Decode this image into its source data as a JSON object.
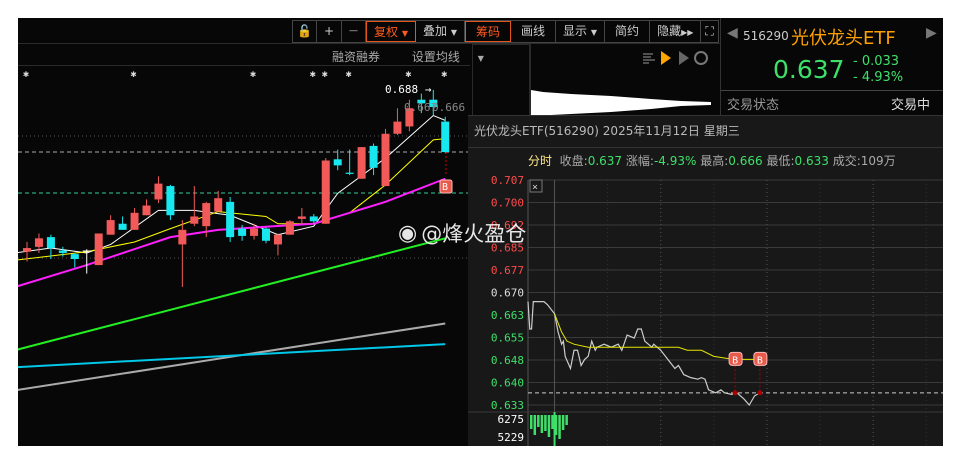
{
  "toolbar": {
    "lock": "🔓",
    "plus": "+",
    "minus": "—",
    "fuquan": "复权",
    "overlay": "叠加",
    "chips": "筹码",
    "draw": "画线",
    "display": "显示",
    "simple": "简约",
    "hide": "隐藏",
    "fullscreen": "⛶"
  },
  "subbar": {
    "margin": "融资融券",
    "ma_setting": "设置均线"
  },
  "quote": {
    "code": "516290",
    "name": "光伏龙头ETF",
    "price": "0.637",
    "change": "- 0.033",
    "change_pct": "- 4.93%",
    "status_label": "交易状态",
    "status_value": "交易中"
  },
  "kline": {
    "high_label": "0.688",
    "label_666": "0.666",
    "label_667": "0.667",
    "candles": [
      [
        0.555,
        0.563,
        0.547,
        0.558
      ],
      [
        0.559,
        0.57,
        0.554,
        0.566
      ],
      [
        0.567,
        0.569,
        0.549,
        0.558
      ],
      [
        0.556,
        0.559,
        0.551,
        0.554
      ],
      [
        0.553,
        0.554,
        0.542,
        0.549
      ],
      [
        0.556,
        0.557,
        0.537,
        0.556
      ],
      [
        0.544,
        0.57,
        0.544,
        0.57
      ],
      [
        0.569,
        0.585,
        0.569,
        0.581
      ],
      [
        0.578,
        0.584,
        0.573,
        0.573
      ],
      [
        0.573,
        0.591,
        0.573,
        0.587
      ],
      [
        0.585,
        0.598,
        0.585,
        0.593
      ],
      [
        0.598,
        0.617,
        0.595,
        0.611
      ],
      [
        0.609,
        0.61,
        0.581,
        0.585
      ],
      [
        0.561,
        0.581,
        0.526,
        0.573
      ],
      [
        0.578,
        0.609,
        0.576,
        0.584
      ],
      [
        0.576,
        0.596,
        0.567,
        0.595
      ],
      [
        0.588,
        0.605,
        0.588,
        0.599
      ],
      [
        0.596,
        0.6,
        0.563,
        0.567
      ],
      [
        0.574,
        0.577,
        0.564,
        0.568
      ],
      [
        0.568,
        0.578,
        0.565,
        0.574
      ],
      [
        0.574,
        0.575,
        0.562,
        0.564
      ],
      [
        0.561,
        0.57,
        0.552,
        0.569
      ],
      [
        0.569,
        0.581,
        0.569,
        0.58
      ],
      [
        0.582,
        0.591,
        0.578,
        0.584
      ],
      [
        0.584,
        0.586,
        0.578,
        0.58
      ],
      [
        0.578,
        0.632,
        0.578,
        0.63
      ],
      [
        0.631,
        0.639,
        0.622,
        0.626
      ],
      [
        0.62,
        0.639,
        0.618,
        0.619
      ],
      [
        0.615,
        0.641,
        0.615,
        0.641
      ],
      [
        0.642,
        0.644,
        0.618,
        0.624
      ],
      [
        0.609,
        0.656,
        0.609,
        0.652
      ],
      [
        0.652,
        0.673,
        0.651,
        0.662
      ],
      [
        0.658,
        0.68,
        0.654,
        0.673
      ],
      [
        0.68,
        0.685,
        0.669,
        0.677
      ],
      [
        0.68,
        0.688,
        0.667,
        0.674
      ],
      [
        0.662,
        0.666,
        0.636,
        0.637
      ]
    ],
    "ma": [
      {
        "color": "#ffffff",
        "pts": [
          [
            -1,
            0.554
          ],
          [
            2,
            0.558
          ],
          [
            5,
            0.554
          ],
          [
            7,
            0.561
          ],
          [
            11,
            0.589
          ],
          [
            14,
            0.589
          ],
          [
            17,
            0.585
          ],
          [
            21,
            0.569
          ],
          [
            24,
            0.576
          ],
          [
            26,
            0.603
          ],
          [
            30,
            0.632
          ],
          [
            34,
            0.667
          ],
          [
            35,
            0.663
          ]
        ]
      },
      {
        "color": "#ffff00",
        "pts": [
          [
            -1,
            0.548
          ],
          [
            5,
            0.555
          ],
          [
            9,
            0.563
          ],
          [
            12,
            0.574
          ],
          [
            16,
            0.588
          ],
          [
            20,
            0.584
          ],
          [
            21,
            0.578
          ],
          [
            24,
            0.578
          ],
          [
            27,
            0.587
          ],
          [
            30,
            0.61
          ],
          [
            34,
            0.647
          ],
          [
            35,
            0.648
          ]
        ]
      },
      {
        "color": "#ff1fff",
        "pts": [
          [
            -1,
            0.526
          ],
          [
            5,
            0.544
          ],
          [
            12,
            0.567
          ],
          [
            16,
            0.573
          ],
          [
            24,
            0.578
          ],
          [
            27,
            0.587
          ],
          [
            30,
            0.596
          ],
          [
            35,
            0.615
          ]
        ]
      },
      {
        "color": "#22ee22",
        "pts": [
          [
            -1,
            0.474
          ],
          [
            35,
            0.566
          ]
        ]
      },
      {
        "color": "#aaaaaa",
        "pts": [
          [
            -1,
            0.441
          ],
          [
            35,
            0.496
          ]
        ]
      },
      {
        "color": "#00c8e8",
        "pts": [
          [
            -1,
            0.46
          ],
          [
            35,
            0.479
          ]
        ]
      }
    ]
  },
  "popup": {
    "title": "光伏龙头ETF(516290) 2025年11月12日 星期三",
    "tab": "分时",
    "close_label": "收盘:",
    "close": "0.637",
    "chg_label": "涨幅:",
    "chg": "-4.93%",
    "high_label": "最高:",
    "high": "0.666",
    "low_label": "最低:",
    "low": "0.633",
    "vol_label": "成交:",
    "vol": "109万",
    "vol_ticks": [
      "6275",
      "5229"
    ],
    "watermark": "@烽火盈仓"
  },
  "chart_data": {
    "type": "line",
    "title": "分时",
    "prev_close": 0.67,
    "y_ticks": [
      "0.707",
      "0.700",
      "0.692",
      "0.685",
      "0.677",
      "0.670",
      "0.663",
      "0.655",
      "0.648",
      "0.640",
      "0.633"
    ],
    "ylim": [
      0.633,
      0.707
    ],
    "xlim_minutes": [
      0,
      240
    ],
    "series": [
      {
        "name": "price",
        "color": "#cccccc",
        "x": [
          0,
          1,
          2,
          3,
          9,
          11,
          15,
          17,
          19,
          20,
          21,
          24,
          26,
          28,
          30,
          32,
          34,
          36,
          38,
          39,
          43,
          47,
          51,
          53,
          56,
          60,
          62,
          64,
          66,
          70,
          71,
          75,
          79,
          83,
          85,
          88,
          92,
          96,
          98,
          100,
          102,
          106,
          109,
          111,
          115,
          118,
          122,
          125,
          128,
          131
        ],
        "y": [
          0.667,
          0.658,
          0.658,
          0.667,
          0.667,
          0.666,
          0.663,
          0.657,
          0.653,
          0.654,
          0.649,
          0.645,
          0.651,
          0.651,
          0.646,
          0.648,
          0.649,
          0.654,
          0.651,
          0.652,
          0.653,
          0.652,
          0.653,
          0.651,
          0.656,
          0.655,
          0.658,
          0.658,
          0.654,
          0.652,
          0.653,
          0.651,
          0.648,
          0.645,
          0.646,
          0.643,
          0.642,
          0.6415,
          0.642,
          0.6415,
          0.638,
          0.637,
          0.638,
          0.637,
          0.6365,
          0.637,
          0.635,
          0.633,
          0.636,
          0.637
        ]
      },
      {
        "name": "avg",
        "color": "#e6e600",
        "x": [
          15,
          19,
          22,
          26,
          34,
          51,
          62,
          71,
          85,
          90,
          98,
          105,
          116,
          131
        ],
        "y": [
          0.663,
          0.657,
          0.654,
          0.653,
          0.652,
          0.652,
          0.652,
          0.652,
          0.652,
          0.651,
          0.651,
          0.649,
          0.648,
          0.648
        ]
      }
    ],
    "markers": [
      {
        "label": "B",
        "x": 117,
        "y": 0.637
      },
      {
        "label": "B",
        "x": 131,
        "y": 0.637
      }
    ]
  }
}
